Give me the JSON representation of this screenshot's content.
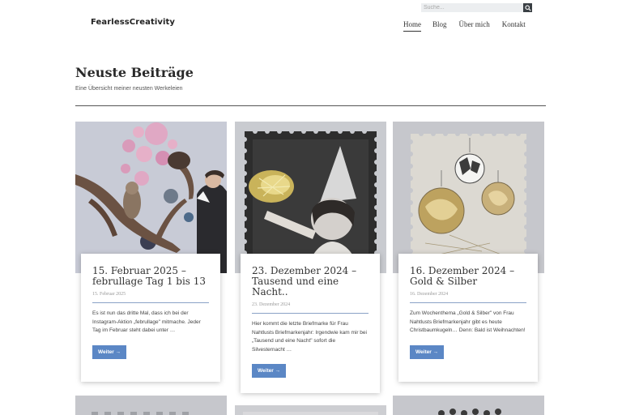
{
  "site": {
    "logo": "FearlessCreativity"
  },
  "search": {
    "placeholder": "Suche..."
  },
  "nav": [
    {
      "label": "Home",
      "active": true
    },
    {
      "label": "Blog"
    },
    {
      "label": "Über mich"
    },
    {
      "label": "Kontakt"
    }
  ],
  "page": {
    "title": "Neuste Beiträge",
    "subtitle": "Eine Übersicht meiner neusten Werkeleien"
  },
  "posts": [
    {
      "title": "15. Februar 2025 – februllage  Tag 1 bis 13",
      "date": "15. Februar 2025",
      "excerpt": "Es ist nun das dritte Mal, dass ich bei der Instagram-Aktion „februllage\" mitmache. Jeder Tag im Februar steht dabei unter …",
      "button": "Weiter →"
    },
    {
      "title": "23. Dezember 2024 – Tausend und eine Nacht..",
      "date": "23. Dezember 2024",
      "excerpt": "Hier kommt die letzte Briefmarke für Frau Nahtlusts Briefmarkenjahr: Irgendwie kam mir bei „Tausend und eine Nacht\" sofort die Silvesternacht …",
      "button": "Weiter →"
    },
    {
      "title": "16. Dezember 2024 – Gold & Silber",
      "date": "16. Dezember 2024",
      "excerpt": "Zum Wochenthema „Gold & Silber\" von Frau Nahtlusts Briefmarkenjahr gibt es heute Christbaumkugeln… Denn: Bald ist Weihnachten!",
      "button": "Weiter →"
    }
  ],
  "colors": {
    "accent": "#5b87c5",
    "separator": "#8aa2c6",
    "text": "#333333"
  }
}
